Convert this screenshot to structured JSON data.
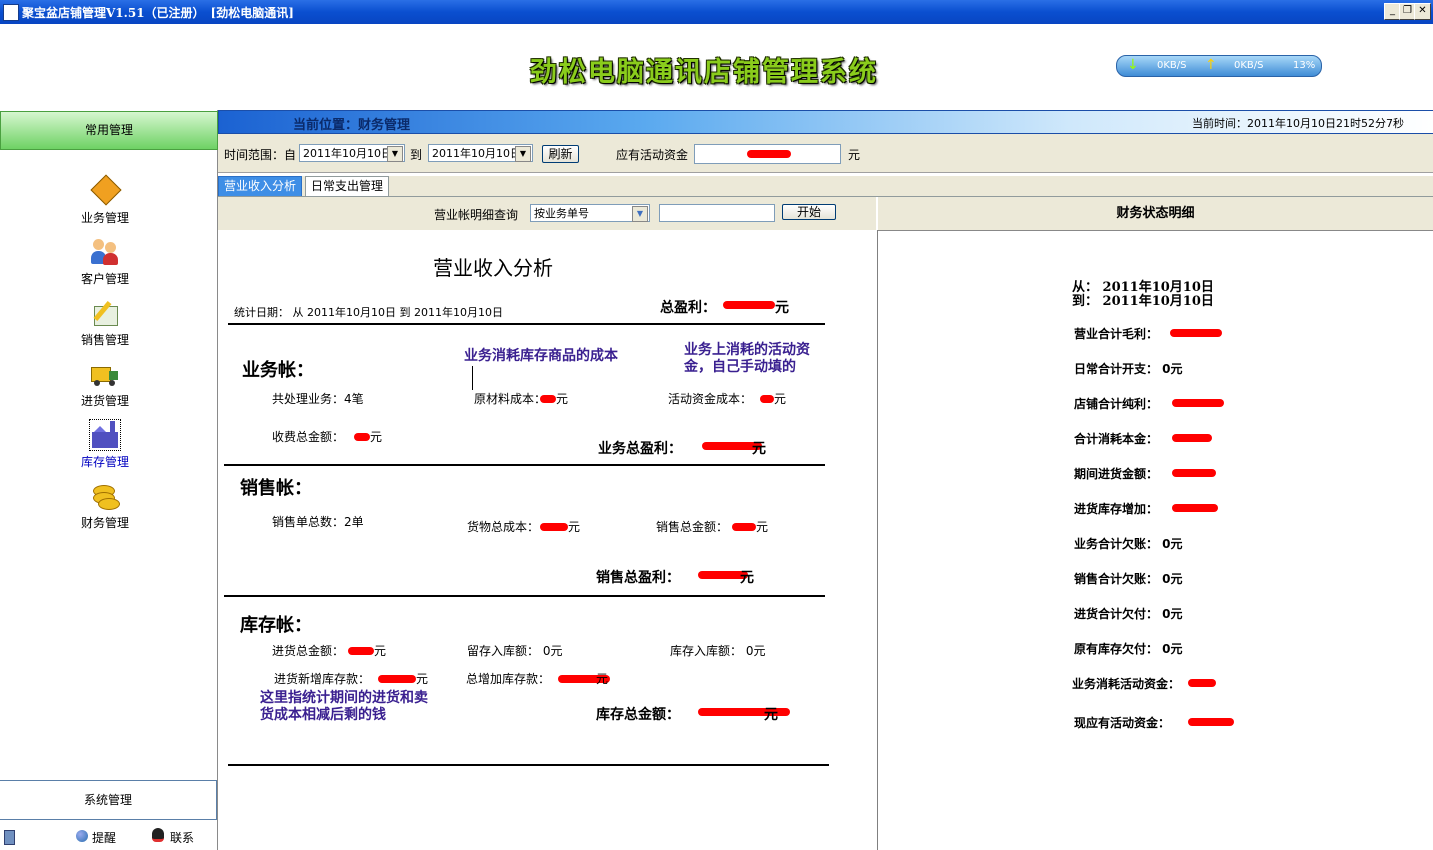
{
  "window": {
    "title": "聚宝盆店铺管理V1.51（已注册）　[劲松电脑通讯]",
    "min_glyph": "_",
    "max_glyph": "❐",
    "close_glyph": "✕"
  },
  "header": {
    "app_title": "劲松电脑通讯店铺管理系统",
    "net_down": "0KB/S",
    "net_up": "0KB/S",
    "cpu": "13%"
  },
  "sidebar": {
    "section": "常用管理",
    "items": [
      {
        "label": "业务管理"
      },
      {
        "label": "客户管理"
      },
      {
        "label": "销售管理"
      },
      {
        "label": "进货管理"
      },
      {
        "label": "库存管理"
      },
      {
        "label": "财务管理"
      }
    ],
    "system": "系统管理",
    "remind": "提醒",
    "contact": "联系"
  },
  "location": {
    "label": "当前位置：财务管理",
    "current_time": "当前时间：2011年10月10日21时52分7秒"
  },
  "filter": {
    "range_label": "时间范围：自",
    "from_date": "2011年10月10日",
    "to_label": "到",
    "to_date": "2011年10月10日",
    "refresh": "刷新",
    "funds_label": "应有活动资金",
    "funds_unit": "元"
  },
  "tabs": [
    "营业收入分析",
    "日常支出管理"
  ],
  "query": {
    "label": "营业帐明细查询",
    "mode": "按业务单号",
    "start": "开始"
  },
  "report": {
    "title": "营业收入分析",
    "stat_date": "统计日期：  从  2011年10月10日  到  2011年10月10日",
    "total_profit_label": "总盈利：",
    "total_profit_suffix": "元",
    "biz_heading": "业务帐：",
    "note_cost": "业务消耗库存商品的成本",
    "note_funds": "业务上消耗的活动资金，自己手动填的",
    "biz_count": "共处理业务：4笔",
    "material_cost": "原材料成本：",
    "material_suffix": "元",
    "funds_cost": "活动资金成本：",
    "funds_suffix": "元",
    "fee_total": "收费总金额：",
    "fee_suffix": "元",
    "biz_profit": "业务总盈利：",
    "biz_profit_suffix": "元",
    "sales_heading": "销售帐：",
    "sales_count": "销售单总数：2单",
    "goods_cost": "货物总成本：",
    "goods_suffix": "元",
    "sales_total": "销售总金额：",
    "sales_suffix": "元",
    "sales_profit": "销售总盈利：",
    "sales_profit_suffix": "元",
    "stock_heading": "库存帐：",
    "purchase_total": "进货总金额：",
    "purchase_suffix": "元",
    "retained_in": "留存入库额：  0元",
    "stock_in": "库存入库额：  0元",
    "new_stock": "进货新增库存款：",
    "new_stock_suffix": "元",
    "added_stock": "总增加库存款：",
    "added_stock_suffix": "元",
    "note_stock": "这里指统计期间的进货和卖货成本相减后剩的钱",
    "stock_total": "库存总金额：",
    "stock_total_suffix": "元"
  },
  "status_panel": {
    "title": "财务状态明细",
    "from": "从：  2011年10月10日",
    "to": "到：  2011年10月10日",
    "rows": [
      "营业合计毛利：",
      "日常合计开支：  0元",
      "店铺合计纯利：",
      "合计消耗本金：",
      "期间进货金额：",
      "进货库存增加：",
      "业务合计欠账：  0元",
      "销售合计欠账：  0元",
      "进货合计欠付：  0元",
      "原有库存欠付：  0元",
      "业务消耗活动资金：",
      "现应有活动资金："
    ]
  }
}
